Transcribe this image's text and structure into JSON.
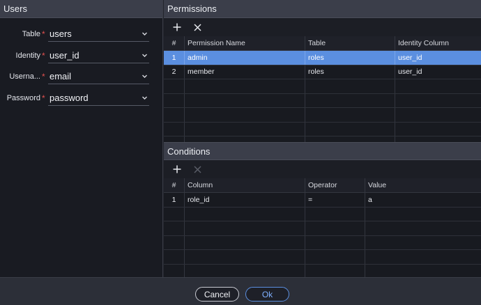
{
  "users": {
    "title": "Users",
    "fields": [
      {
        "label": "Table",
        "value": "users"
      },
      {
        "label": "Identity",
        "value": "user_id"
      },
      {
        "label": "Userna...",
        "value": "email"
      },
      {
        "label": "Password",
        "value": "password"
      }
    ],
    "required_mark": "*"
  },
  "permissions": {
    "title": "Permissions",
    "columns": [
      "#",
      "Permission Name",
      "Table",
      "Identity Column"
    ],
    "rows": [
      {
        "num": "1",
        "name": "admin",
        "table": "roles",
        "identity": "user_id",
        "selected": true
      },
      {
        "num": "2",
        "name": "member",
        "table": "roles",
        "identity": "user_id",
        "selected": false
      }
    ]
  },
  "conditions": {
    "title": "Conditions",
    "columns": [
      "#",
      "Column",
      "Operator",
      "Value"
    ],
    "rows": [
      {
        "num": "1",
        "column": "role_id",
        "operator": "=",
        "value": "a"
      }
    ]
  },
  "footer": {
    "cancel_label": "Cancel",
    "ok_label": "Ok"
  },
  "colors": {
    "accent": "#5b8fe0",
    "required": "#e0514f",
    "background": "#191b22"
  },
  "icons": {
    "add": "plus-icon",
    "remove": "close-icon",
    "dropdown": "chevron-down-icon"
  }
}
